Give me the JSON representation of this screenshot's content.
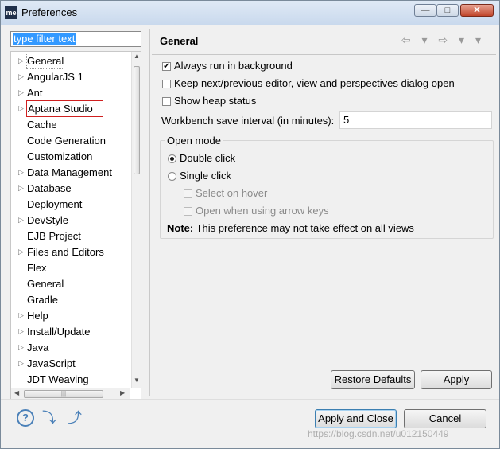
{
  "window": {
    "title": "Preferences",
    "app_icon_text": "me",
    "minimize": "—",
    "maximize": "□",
    "close": "✕"
  },
  "filter": {
    "value": "type filter text"
  },
  "tree": {
    "items": [
      {
        "label": "General",
        "expandable": true
      },
      {
        "label": "AngularJS 1",
        "expandable": true
      },
      {
        "label": "Ant",
        "expandable": true
      },
      {
        "label": "Aptana Studio",
        "expandable": true
      },
      {
        "label": "Cache",
        "expandable": false
      },
      {
        "label": "Code Generation",
        "expandable": false
      },
      {
        "label": "Customization",
        "expandable": false
      },
      {
        "label": "Data Management",
        "expandable": true
      },
      {
        "label": "Database",
        "expandable": true
      },
      {
        "label": "Deployment",
        "expandable": false
      },
      {
        "label": "DevStyle",
        "expandable": true
      },
      {
        "label": "EJB Project",
        "expandable": false
      },
      {
        "label": "Files and Editors",
        "expandable": true
      },
      {
        "label": "Flex",
        "expandable": false
      },
      {
        "label": "General",
        "expandable": false
      },
      {
        "label": "Gradle",
        "expandable": false
      },
      {
        "label": "Help",
        "expandable": true
      },
      {
        "label": "Install/Update",
        "expandable": true
      },
      {
        "label": "Java",
        "expandable": true
      },
      {
        "label": "JavaScript",
        "expandable": true
      },
      {
        "label": "JDT Weaving",
        "expandable": false
      }
    ]
  },
  "page": {
    "title": "General",
    "nav_arrows": "⇦ ▾ ⇨ ▾ ▾",
    "always_run_background": {
      "label": "Always run in background",
      "checked": true
    },
    "keep_next_previous": {
      "label": "Keep next/previous editor, view and perspectives dialog open",
      "checked": false
    },
    "show_heap_status": {
      "label": "Show heap status",
      "checked": false
    },
    "save_interval": {
      "label": "Workbench save interval (in minutes):",
      "value": "5"
    },
    "open_mode": {
      "title": "Open mode",
      "double_click": "Double click",
      "single_click": "Single click",
      "select_on_hover": "Select on hover",
      "open_arrow_keys": "Open when using arrow keys",
      "note_bold": "Note:",
      "note_text": " This preference may not take effect on all views"
    },
    "restore_defaults": "Restore Defaults",
    "apply": "Apply"
  },
  "footer": {
    "help_icon": "?",
    "apply_and_close": "Apply and Close",
    "cancel": "Cancel",
    "watermark": "https://blog.csdn.net/u012150449"
  },
  "colors": {
    "accent_selection": "#3399ff",
    "highlight_box": "#d02020"
  }
}
